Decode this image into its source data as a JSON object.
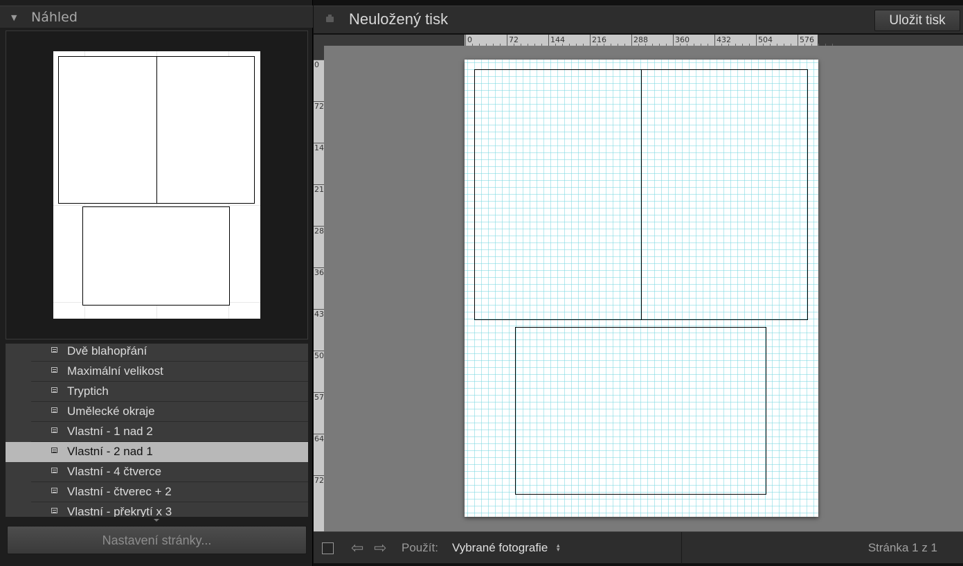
{
  "preview_panel": {
    "title": "Náhled",
    "collapse_icon": "triangle-down-icon"
  },
  "template_list": {
    "item_icon": "layout-template-icon",
    "items": [
      {
        "label": "Dvě blahopřání",
        "selected": false
      },
      {
        "label": "Maximální velikost",
        "selected": false
      },
      {
        "label": "Tryptich",
        "selected": false
      },
      {
        "label": "Umělecké okraje",
        "selected": false
      },
      {
        "label": "Vlastní - 1 nad 2",
        "selected": false
      },
      {
        "label": "Vlastní - 2 nad 1",
        "selected": true
      },
      {
        "label": "Vlastní - 4 čtverce",
        "selected": false
      },
      {
        "label": "Vlastní - čtverec + 2",
        "selected": false
      },
      {
        "label": "Vlastní - překrytí x 3",
        "selected": false
      }
    ]
  },
  "page_setup_button": {
    "label": "Nastavení stránky..."
  },
  "header": {
    "title": "Neuložený tisk",
    "save_button": "Uložit tisk",
    "print_icon": "printer-icon"
  },
  "rulers": {
    "top_labels": [
      "0",
      "72",
      "144",
      "216",
      "288",
      "360",
      "432",
      "504",
      "576"
    ],
    "left_labels": [
      "0",
      "72",
      "14",
      "21",
      "28",
      "36",
      "43",
      "50",
      "57",
      "64",
      "72"
    ]
  },
  "bottom_toolbar": {
    "use_label": "Použít:",
    "use_value": "Vybrané fotografie",
    "page_indicator": "Stránka 1 z 1",
    "prev_icon": "arrow-left-icon",
    "next_icon": "arrow-right-icon"
  },
  "colors": {
    "selected_row": "#b8b8b8",
    "grid_line": "#78d7e1",
    "canvas_bg": "#7a7a7a"
  }
}
